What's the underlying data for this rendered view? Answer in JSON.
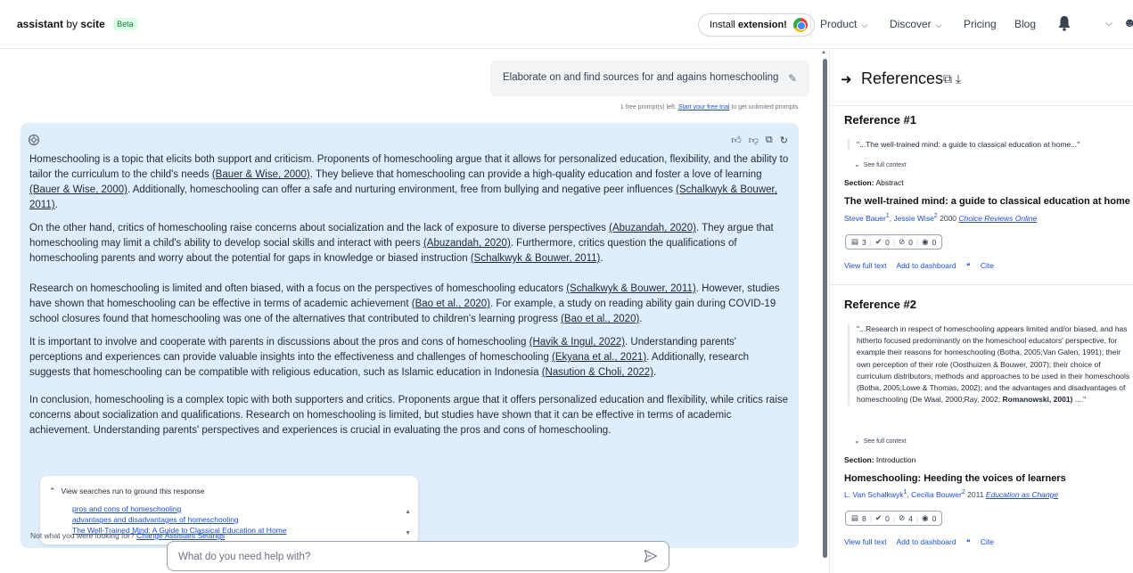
{
  "app": {
    "brand_main": "assistant",
    "brand_by": "by",
    "brand_name": "scite",
    "beta": "Beta"
  },
  "header": {
    "install_prefix": "Install",
    "install_bold": "extension!",
    "nav": {
      "product": "Product",
      "discover": "Discover",
      "pricing": "Pricing",
      "blog": "Blog"
    }
  },
  "prompt": {
    "text": "Elaborate on and find sources for and agains homeschooling",
    "free_note_prefix": "1 free prompt(s) left.",
    "free_note_link": "Start your free trial",
    "free_note_suffix": "to get unlimited prompts."
  },
  "answer": {
    "paragraphs": [
      [
        {
          "t": "Homeschooling is a topic that elicits both support and criticism. Proponents of homeschooling argue that it allows for personalized education, flexibility, and the ability to tailor the curriculum to the child's needs "
        },
        {
          "c": "(Bauer & Wise, 2000)"
        },
        {
          "t": ". They believe that homeschooling can provide a high-quality education and foster a love of learning "
        },
        {
          "c": "(Bauer & Wise, 2000)"
        },
        {
          "t": ". Additionally, homeschooling can offer a safe and nurturing environment, free from bullying and negative peer influences "
        },
        {
          "c": "(Schalkwyk & Bouwer, 2011)"
        },
        {
          "t": "."
        }
      ],
      [
        {
          "t": "On the other hand, critics of homeschooling raise concerns about socialization and the lack of exposure to diverse perspectives "
        },
        {
          "c": "(Abuzandah, 2020)"
        },
        {
          "t": ". They argue that homeschooling may limit a child's ability to develop social skills and interact with peers "
        },
        {
          "c": "(Abuzandah, 2020)"
        },
        {
          "t": ". Furthermore, critics question the qualifications of homeschooling parents and worry about the potential for gaps in knowledge or biased instruction "
        },
        {
          "c": "(Schalkwyk & Bouwer, 2011)"
        },
        {
          "t": "."
        }
      ],
      [
        {
          "t": "Research on homeschooling is limited and often biased, with a focus on the perspectives of homeschooling educators "
        },
        {
          "c": "(Schalkwyk & Bouwer, 2011)"
        },
        {
          "t": ". However, studies have shown that homeschooling can be effective in terms of academic achievement "
        },
        {
          "c": "(Bao et al., 2020)"
        },
        {
          "t": ". For example, a study on reading ability gain during COVID-19 school closures found that homeschooling was one of the alternatives that contributed to children's learning progress "
        },
        {
          "c": "(Bao et al., 2020)"
        },
        {
          "t": "."
        }
      ],
      [
        {
          "t": "It is important to involve and cooperate with parents in discussions about the pros and cons of homeschooling "
        },
        {
          "c": "(Havik & Ingul, 2022)"
        },
        {
          "t": ". Understanding parents' perceptions and experiences can provide valuable insights into the effectiveness and challenges of homeschooling "
        },
        {
          "c": "(Ekyana et al., 2021)"
        },
        {
          "t": ". Additionally, research suggests that homeschooling can be compatible with religious education, such as Islamic education in Indonesia "
        },
        {
          "c": "(Nasution & Choli, 2022)"
        },
        {
          "t": "."
        }
      ],
      [
        {
          "t": "In conclusion, homeschooling is a complex topic with both supporters and critics. Proponents argue that it offers personalized education and flexibility, while critics raise concerns about socialization and qualifications. Research on homeschooling is limited, but studies have shown that it can be effective in terms of academic achievement. Understanding parents' perspectives and experiences is crucial in evaluating the pros and cons of homeschooling."
        }
      ]
    ],
    "searches_title": "View searches run to ground this response",
    "searches": [
      "pros and cons of homeschooling",
      "advantages and disadvantages of homeschooling",
      "The Well-Trained Mind: A Guide to Classical Education at Home"
    ],
    "not_what_prefix": "Not what you were looking for?",
    "not_what_link": "Change Assistant Settings"
  },
  "input": {
    "placeholder": "What do you need help with?"
  },
  "references": {
    "title": "References",
    "items": [
      {
        "heading": "Reference #1",
        "quote": "\"...The well-trained mind: a guide to classical education at home...\"",
        "see_full": "See full context",
        "section_label": "Section:",
        "section": "Abstract",
        "title": "The well-trained mind: a guide to classical education at home",
        "author1": "Steve Bauer",
        "author1_sup": "1",
        "author2": "Jessie Wise",
        "author2_sup": "2",
        "year": "2000",
        "journal": "Choice Reviews Online",
        "counts": [
          "3",
          "0",
          "0",
          "0"
        ],
        "actions": [
          "View full text",
          "Add to dashboard",
          "Cite"
        ]
      },
      {
        "heading": "Reference #2",
        "quote_plain": "\"...Research in respect of homeschooling appears limited and/or biased, and has hitherto focused predominantly on the homeschool educators' perspective, for example their reasons for homeschooling (Botha, 2005;Van Galen, 1991); their own perception of their role (Oosthuizen & Bouwer, 2007); their choice of curriculum distributors, methods and approaches to be used in their homeschools (Botha, 2005;Lowe & Thomas, 2002); and the advantages and disadvantages of homeschooling (De Waal, 2000;Ray, 2002; ",
        "quote_bold": "Romanowski, 2001)",
        "quote_end": " ....\"",
        "see_full": "See full context",
        "section_label": "Section:",
        "section": "Introduction",
        "title": "Homeschooling: Heeding the voices of learners",
        "author1": "L. Van Schalkwyk",
        "author1_sup": "1",
        "author2": "Cecilia Bouwer",
        "author2_sup": "2",
        "year": "2011",
        "journal": "Education as Change",
        "counts": [
          "8",
          "0",
          "4",
          "0"
        ],
        "actions": [
          "View full text",
          "Add to dashboard",
          "Cite"
        ]
      }
    ]
  },
  "colors": {
    "answer_bg": "#e0eefb",
    "link": "#1d4ed8",
    "beta_bg": "#dcfce7"
  }
}
